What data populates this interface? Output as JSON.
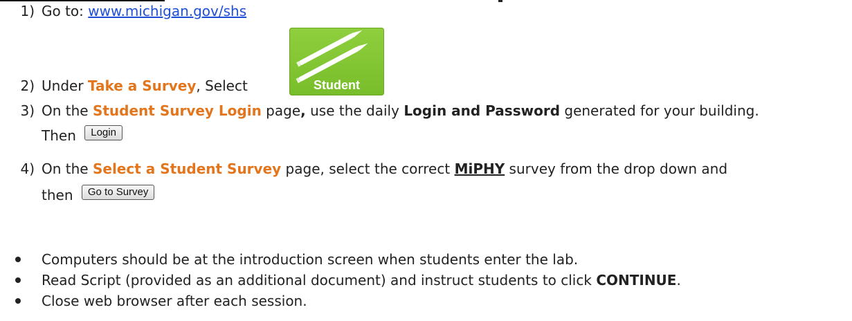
{
  "steps": [
    {
      "number": "1)",
      "prefix": "Go to: ",
      "link": "www.michigan.gov/shs"
    },
    {
      "number": "2)",
      "prefix": "Under ",
      "highlight": "Take a Survey",
      "suffix": ", Select",
      "tile_label": "Student",
      "tile_icon": "pencils-icon",
      "tile_color": "#7fc433"
    },
    {
      "number": "3)",
      "prefix": "On the ",
      "highlight": "Student Survey Login",
      "middle": " page",
      "comma": ",",
      "middle2": " use the daily ",
      "bold": "Login and Password",
      "suffix": " generated for your building.",
      "then": "Then",
      "button": "Login"
    },
    {
      "number": "4)",
      "prefix": "On the ",
      "highlight": "Select a Student Survey",
      "middle": " page, select the correct ",
      "bold_underline": "MiPHY",
      "suffix": " survey from the drop down and",
      "then": "then",
      "button": "Go to Survey"
    }
  ],
  "bullets": [
    {
      "text": "Computers should be at the introduction screen when students enter the lab."
    },
    {
      "prefix": "Read Script (provided as an additional document) and instruct students to click ",
      "bold": "CONTINUE",
      "suffix": "."
    },
    {
      "text": "Close web browser after each session."
    }
  ],
  "colors": {
    "highlight": "#e3761c",
    "link": "#1f4ed8"
  }
}
